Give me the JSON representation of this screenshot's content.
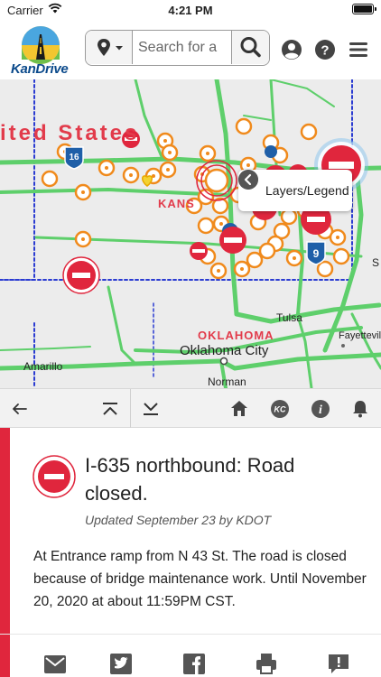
{
  "status_bar": {
    "carrier": "Carrier",
    "time": "4:21 PM"
  },
  "header": {
    "logo_text": "KanDrive",
    "search_placeholder": "Search for a",
    "icons": [
      "location-icon",
      "search-icon",
      "account-icon",
      "help-icon",
      "menu-icon"
    ]
  },
  "map": {
    "labels": {
      "country": "ited States",
      "kansas": "KANS",
      "oklahoma": "OKLAHOMA",
      "tulsa": "Tulsa",
      "oklahoma_city": "Oklahoma City",
      "norman": "Norman",
      "amarillo": "Amarillo",
      "fayetteville": "Fayettevill",
      "state_letter": "S"
    },
    "shields": [
      "16",
      "9"
    ],
    "layers_button": "Layers/Legend",
    "colors": {
      "road": "#5ecf6b",
      "construction": "#f08a1c",
      "closure": "#e0263d",
      "border": "#2a3bd1"
    }
  },
  "toolbar": {
    "buttons": [
      "back-icon",
      "collapse-top-icon",
      "collapse-bottom-icon",
      "home-icon",
      "kc-icon",
      "info-icon",
      "notification-icon"
    ],
    "kc_label": "KC"
  },
  "event": {
    "title": "I-635 northbound: Road closed.",
    "updated": "Updated September 23 by KDOT",
    "description": "At Entrance ramp from N 43 St. The road is closed because of bridge maintenance work. Until November 20, 2020 at about 11:59PM CST.",
    "accent_color": "#e0263d"
  },
  "share": {
    "buttons": [
      "email-icon",
      "twitter-icon",
      "facebook-icon",
      "print-icon",
      "feedback-icon"
    ]
  }
}
